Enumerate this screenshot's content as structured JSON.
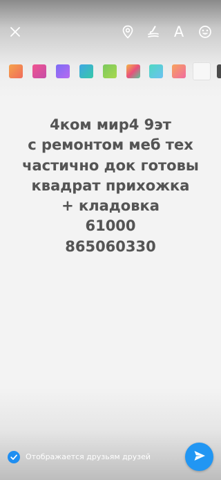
{
  "toolbar": {
    "close_icon": "close-icon",
    "location_icon": "location-pin-icon",
    "draw_icon": "brush-icon",
    "text_tool_label": "A",
    "sticker_icon": "smiley-icon"
  },
  "palette": {
    "swatches": [
      {
        "name": "orange-gradient",
        "colors": [
          "#f5a34a",
          "#f06b5b"
        ]
      },
      {
        "name": "pink-gradient",
        "colors": [
          "#f0558f",
          "#c54ca8"
        ]
      },
      {
        "name": "purple-gradient",
        "colors": [
          "#7b6cf5",
          "#b86af0"
        ]
      },
      {
        "name": "teal-gradient",
        "colors": [
          "#3fa7e3",
          "#36c8a8"
        ]
      },
      {
        "name": "green-gradient",
        "colors": [
          "#7bc95e",
          "#a8d84e"
        ]
      },
      {
        "name": "rainbow-gradient",
        "colors": [
          "#f3b746",
          "#e9507b",
          "#57c79a"
        ]
      },
      {
        "name": "aqua-gradient",
        "colors": [
          "#4fd8c2",
          "#6bc1f1"
        ]
      },
      {
        "name": "peach-gradient",
        "colors": [
          "#f7a35c",
          "#f06ba1"
        ]
      },
      {
        "name": "white",
        "colors": [
          "#f7f7f7"
        ]
      },
      {
        "name": "dark",
        "colors": [
          "#4a4a4a"
        ]
      }
    ]
  },
  "story_text": {
    "lines": [
      "4ком мир4 9эт",
      "с ремонтом меб тех",
      "частично док готовы",
      "квадрат прихожка",
      "+ кладовка",
      "61000",
      "865060330"
    ],
    "color": "#545454"
  },
  "bottom": {
    "visibility_label": "Отображается друзьям друзей",
    "check_icon": "checkmark-icon",
    "send_icon": "send-arrow-icon",
    "accent": "#2196f3"
  }
}
